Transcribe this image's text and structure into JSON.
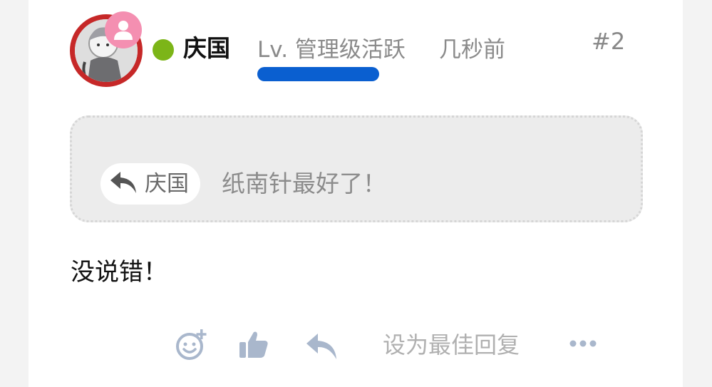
{
  "post": {
    "username": "庆国",
    "level_text": "Lv. 管理级活跃",
    "time_text": "几秒前",
    "floor_text": "#2",
    "online": true,
    "level_bar_color": "#0a5fd0",
    "online_color": "#7cb518"
  },
  "quote": {
    "author": "庆国",
    "text": "纸南针最好了！",
    "icon": "reply-arrow-icon"
  },
  "body": {
    "text": "没说错！"
  },
  "actions": {
    "emoji_icon": "add-reaction-icon",
    "like_icon": "thumbs-up-icon",
    "reply_icon": "reply-icon",
    "best_answer_label": "设为最佳回复",
    "more_icon": "more-dots-icon"
  },
  "colors": {
    "avatar_ring": "#c62828",
    "badge": "#f48fb1",
    "action_icon": "#a9b7cc"
  }
}
